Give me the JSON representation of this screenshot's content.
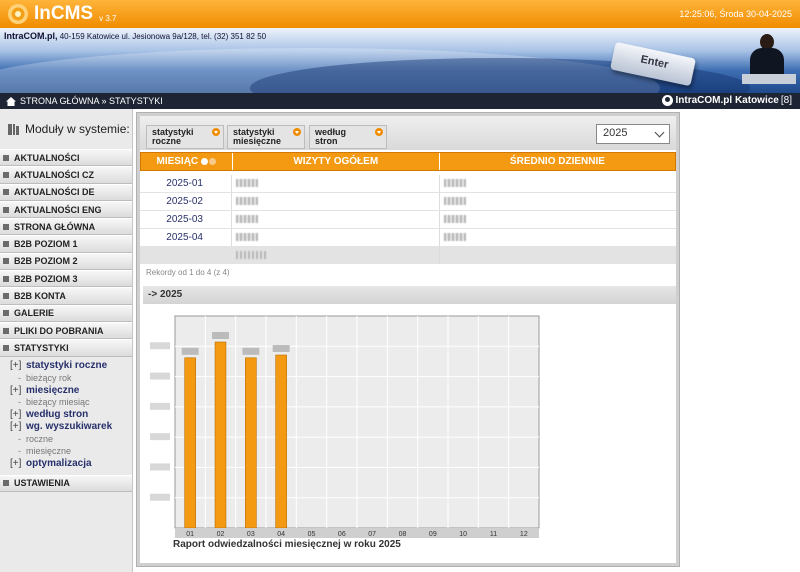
{
  "header": {
    "app_title": "InCMS",
    "version": "v 3.7",
    "datetime": "12:25:06, Środa 30-04-2025",
    "company_name": "IntraCOM.pl,",
    "company_address": "40-159 Katowice  ul. Jesionowa 9a/128,  tel. (32) 351 82 50",
    "banner_key_label": "Enter"
  },
  "breadcrumb": {
    "path": "STRONA GŁÓWNA » STATYSTYKI",
    "user_label": "IntraCOM.pl Katowice",
    "user_count": "[8]"
  },
  "sidebar": {
    "title": "Moduły w systemie:",
    "items_top": [
      "AKTUALNOŚCI",
      "AKTUALNOŚCI CZ",
      "AKTUALNOŚCI DE",
      "AKTUALNOŚCI ENG",
      "STRONA GŁÓWNA",
      "B2B POZIOM 1",
      "B2B POZIOM 2",
      "B2B POZIOM 3",
      "B2B KONTA",
      "GALERIE",
      "PLIKI DO POBRANIA",
      "STATYSTYKI"
    ],
    "stats_submenu": [
      {
        "plus": "[+]",
        "label": "statystyki roczne"
      },
      {
        "child": "bieżący rok"
      },
      {
        "plus": "[+]",
        "label": "miesięczne"
      },
      {
        "child": "bieżący miesiąc"
      },
      {
        "plus": "[+]",
        "label": "według stron"
      },
      {
        "plus": "[+]",
        "label": "wg. wyszukiwarek"
      },
      {
        "child": "roczne"
      },
      {
        "child": "miesięczne"
      },
      {
        "plus": "[+]",
        "label": "optymalizacja"
      }
    ],
    "items_bottom": [
      "USTAWIENIA"
    ]
  },
  "tabs": [
    {
      "line1": "statystyki",
      "line2": "roczne"
    },
    {
      "line1": "statystyki",
      "line2": "miesięczne"
    },
    {
      "line1": "według",
      "line2": "stron"
    }
  ],
  "year_select": {
    "value": "2025"
  },
  "table": {
    "headers": {
      "month": "MIESIĄC",
      "visits": "WIZYTY OGÓŁEM",
      "daily": "ŚREDNIO DZIENNIE"
    },
    "rows": [
      {
        "month": "2025-01"
      },
      {
        "month": "2025-02"
      },
      {
        "month": "2025-03"
      },
      {
        "month": "2025-04"
      }
    ],
    "records_info": "Rekordy od 1 do 4 (z 4)"
  },
  "section": {
    "label": "-> 2025"
  },
  "chart_data": {
    "type": "bar",
    "title": "Raport odwiedzalności miesięcznej w roku 2025",
    "categories": [
      "01",
      "02",
      "03",
      "04",
      "05",
      "06",
      "07",
      "08",
      "09",
      "10",
      "11",
      "12"
    ],
    "values": [
      0.915,
      1.0,
      0.915,
      0.93,
      0,
      0,
      0,
      0,
      0,
      0,
      0,
      0
    ],
    "grid": true,
    "bar_color": "#f39a12",
    "note": ""
  },
  "colors": {
    "accent": "#f39a12",
    "header_orange": "#f08c00",
    "nav_dark": "#1d2433",
    "link": "#27306b"
  }
}
